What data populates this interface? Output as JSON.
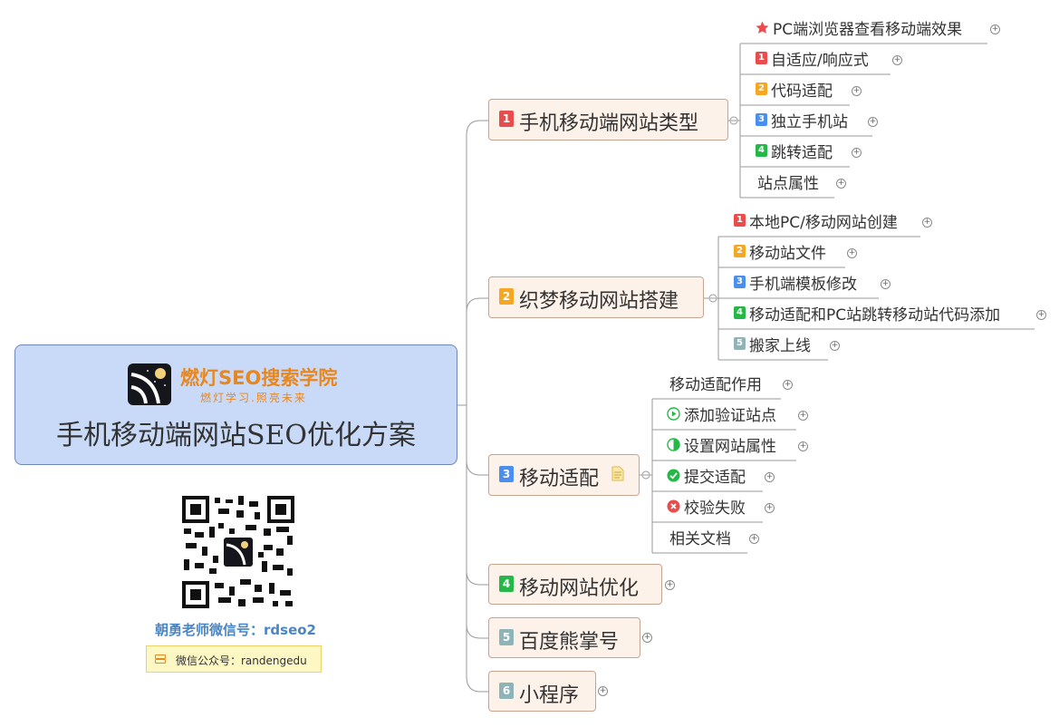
{
  "root": {
    "brand_name": "燃灯SEO搜索学院",
    "brand_slogan": "燃灯学习.照亮未来",
    "title": "手机移动端网站SEO优化方案"
  },
  "sidebar": {
    "wechat": "朝勇老师微信号：rdseo2",
    "public_account": "微信公众号：randengedu"
  },
  "colors": {
    "red": "#e84c4c",
    "orange": "#f5a623",
    "blue": "#4a8ef0",
    "green": "#25b848",
    "grey": "#8fb4b8"
  },
  "topics": [
    {
      "num": "1",
      "label": "手机移动端网站类型"
    },
    {
      "num": "2",
      "label": "织梦移动网站搭建"
    },
    {
      "num": "3",
      "label": "移动适配"
    },
    {
      "num": "4",
      "label": "移动网站优化"
    },
    {
      "num": "5",
      "label": "百度熊掌号"
    },
    {
      "num": "6",
      "label": "小程序"
    }
  ],
  "subtopics": {
    "t1": [
      {
        "icon": "star-icon",
        "label": "PC端浏览器查看移动端效果"
      },
      {
        "badge": "1",
        "label": "自适应/响应式"
      },
      {
        "badge": "2",
        "label": "代码适配"
      },
      {
        "badge": "3",
        "label": "独立手机站"
      },
      {
        "badge": "4",
        "label": "跳转适配"
      },
      {
        "label": "站点属性"
      }
    ],
    "t2": [
      {
        "badge": "1",
        "label": "本地PC/移动网站创建"
      },
      {
        "badge": "2",
        "label": "移动站文件"
      },
      {
        "badge": "3",
        "label": "手机端模板修改"
      },
      {
        "badge": "4",
        "label": "移动适配和PC站跳转移动站代码添加"
      },
      {
        "badge": "5",
        "label": "搬家上线"
      }
    ],
    "t3": [
      {
        "label": "移动适配作用"
      },
      {
        "icon": "play-icon",
        "label": "添加验证站点"
      },
      {
        "icon": "half-circle-icon",
        "label": "设置网站属性"
      },
      {
        "icon": "check-icon",
        "label": "提交适配"
      },
      {
        "icon": "cross-icon",
        "label": "校验失败"
      },
      {
        "label": "相关文档"
      }
    ]
  }
}
